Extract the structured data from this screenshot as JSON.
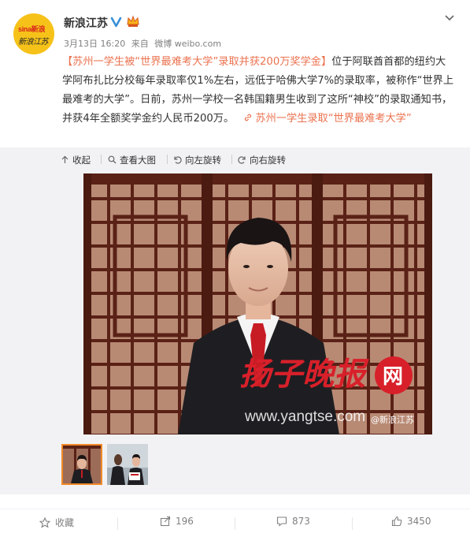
{
  "account": {
    "name": "新浪江苏",
    "avatar_top": "sina新浪",
    "avatar_bottom": "新浪江苏",
    "verified_icon": "verified-v-icon",
    "member_icon": "vip-crown-icon"
  },
  "post": {
    "date": "3月13日 16:20",
    "source_prefix": "来自",
    "source": "微博 weibo.com",
    "title": "【苏州一学生被“世界最难考大学”录取并获200万奖学金】",
    "body": "位于阿联酋首都的纽约大学阿布扎比分校每年录取率仅1%左右，远低于哈佛大学7%的录取率，被称作“世界上最难考的大学”。日前，苏州一学校一名韩国籍男生收到了这所“神校”的录取通知书，并获4年全额奖学金约人民币200万。",
    "topic_icon": "link-icon",
    "topic": "苏州一学生录取“世界最难考大学”"
  },
  "media_toolbar": {
    "collapse": "收起",
    "view_large": "查看大图",
    "rotate_left": "向左旋转",
    "rotate_right": "向右旋转"
  },
  "photo": {
    "watermark_brand": "扬子晚报",
    "watermark_badge": "网",
    "watermark_url": "www.yangtse.com",
    "watermark_handle": "@新浪江苏"
  },
  "actions": {
    "favorite": "收藏",
    "repost_count": "196",
    "comment_count": "873",
    "like_count": "3450"
  },
  "colors": {
    "accent": "#eb7350",
    "thumb_border": "#f28a28",
    "avatar_bg": "#f6c21a"
  }
}
